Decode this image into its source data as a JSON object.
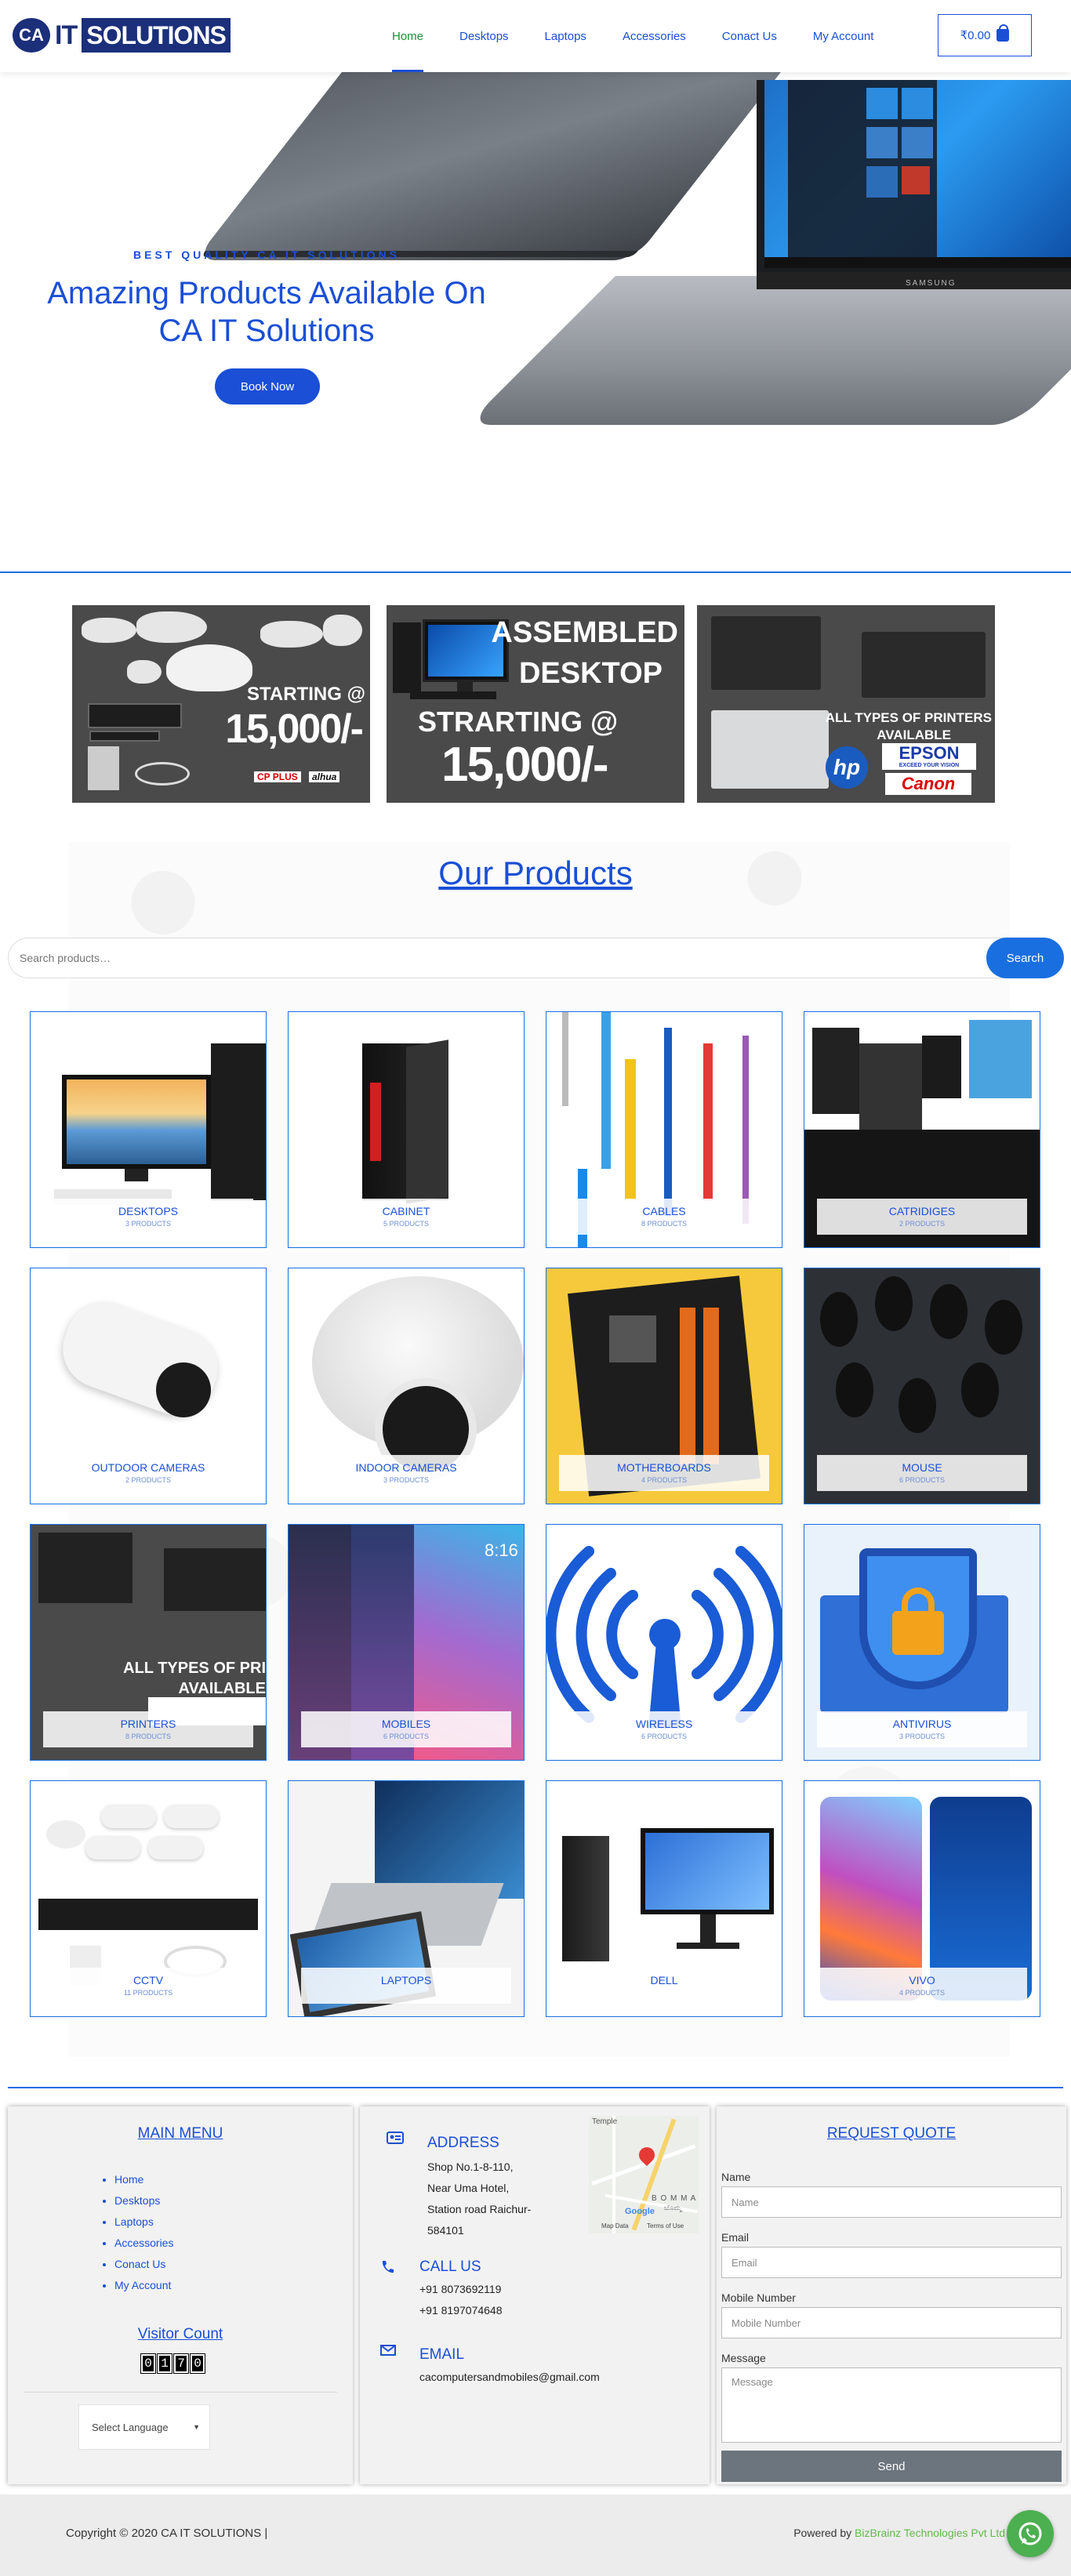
{
  "header": {
    "logo": {
      "monogram": "CA",
      "word1": "IT",
      "word2": "SOLUTIONS"
    },
    "nav": [
      {
        "label": "Home",
        "active": true
      },
      {
        "label": "Desktops"
      },
      {
        "label": "Laptops"
      },
      {
        "label": "Accessories"
      },
      {
        "label": "Conact Us"
      },
      {
        "label": "My Account"
      }
    ],
    "cart_total": "₹0.00",
    "cart_icon": "shopping-bag-icon"
  },
  "hero": {
    "kicker": "BEST QUALITY CA IT SOLUTIONS",
    "title_line1": "Amazing Products Available On",
    "title_line2": "CA IT Solutions",
    "button": "Book Now",
    "laptop_brand": "SAMSUNG"
  },
  "banners": {
    "cctv": {
      "line1": "STARTING @",
      "line2": "15,000/-",
      "brand1": "CP PLUS",
      "brand2": "alhua"
    },
    "desktop": {
      "line1": "ASSEMBLED",
      "line2": "DESKTOP",
      "line3": "STRARTING @",
      "line4": "15,000/-"
    },
    "printers": {
      "line1": "ALL TYPES OF PRINTERS",
      "line2": "AVAILABLE",
      "brand_hp": "hp",
      "brand_epson": "EPSON",
      "epson_sub": "EXCEED YOUR VISION",
      "brand_canon": "Canon"
    }
  },
  "products": {
    "title": "Our Products",
    "search_placeholder": "Search products…",
    "search_button": "Search",
    "items": [
      {
        "name": "DESKTOPS",
        "count": "3 PRODUCTS"
      },
      {
        "name": "CABINET",
        "count": "5 PRODUCTS"
      },
      {
        "name": "CABLES",
        "count": "8 PRODUCTS"
      },
      {
        "name": "CATRIDIGES",
        "count": "2 PRODUCTS"
      },
      {
        "name": "OUTDOOR CAMERAS",
        "count": "2 PRODUCTS"
      },
      {
        "name": "INDOOR CAMERAS",
        "count": "3 PRODUCTS"
      },
      {
        "name": "MOTHERBOARDS",
        "count": "4 PRODUCTS"
      },
      {
        "name": "MOUSE",
        "count": "6 PRODUCTS"
      },
      {
        "name": "PRINTERS",
        "count": "8 PRODUCTS"
      },
      {
        "name": "MOBILES",
        "count": "6 PRODUCTS"
      },
      {
        "name": "WIRELESS",
        "count": "6 PRODUCTS"
      },
      {
        "name": "ANTIVIRUS",
        "count": "3 PRODUCTS"
      },
      {
        "name": "CCTV",
        "count": "11 PRODUCTS"
      },
      {
        "name": "LAPTOPS",
        "count": ""
      },
      {
        "name": "DELL",
        "count": ""
      },
      {
        "name": "VIVO",
        "count": "4 PRODUCTS"
      }
    ],
    "printer_overlay": {
      "line1": "ALL TYPES OF PRI",
      "line2": "AVAILABLE"
    },
    "phone_time": "8:16"
  },
  "footer": {
    "main_menu_title": "MAIN MENU",
    "menu": [
      "Home",
      "Desktops",
      "Laptops",
      "Accessories",
      "Conact Us",
      "My Account"
    ],
    "visitor_title": "Visitor Count",
    "visitor_digits": [
      "0",
      "1",
      "7",
      "0"
    ],
    "language": "Select Language",
    "address_title": "ADDRESS",
    "address_lines": [
      "Shop No.1-8-110,",
      "Near Uma Hotel,",
      "Station road Raichur-",
      "584101"
    ],
    "call_title": "CALL US",
    "phones": [
      "+91 8073692119",
      "+91 8197074648"
    ],
    "email_title": "EMAIL",
    "email": "cacomputersandmobiles@gmail.com",
    "map": {
      "label_top": "Temple",
      "label_town": "B O M M A",
      "label_kn": "ಬೊಮ್ಮ",
      "brand": "Google",
      "data": "Map Data",
      "terms": "Terms of Use"
    },
    "quote_title": "REQUEST QUOTE",
    "quote_fields": [
      {
        "label": "Name",
        "placeholder": "Name"
      },
      {
        "label": "Email",
        "placeholder": "Email"
      },
      {
        "label": "Mobile Number",
        "placeholder": "Mobile Number"
      },
      {
        "label": "Message",
        "placeholder": "Message"
      }
    ],
    "quote_button": "Send",
    "copyright": "Copyright © 2020 CA IT SOLUTIONS |",
    "powered_prefix": "Powered by ",
    "powered_link": "BizBrainz Technologies Pvt Ltd"
  }
}
